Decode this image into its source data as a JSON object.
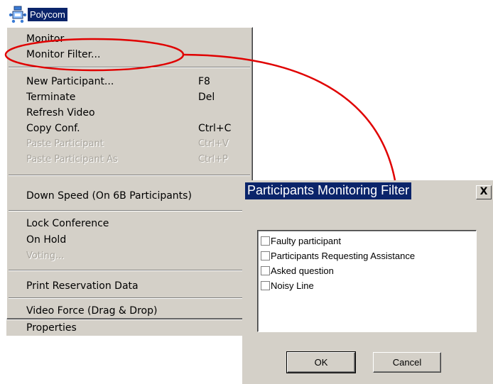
{
  "node": {
    "label": "Polycom",
    "icon": "conference-node-icon"
  },
  "menu": {
    "items": [
      {
        "label": "Monitor",
        "shortcut": ""
      },
      {
        "label": "Monitor Filter...",
        "shortcut": ""
      },
      {
        "label": "New Participant...",
        "shortcut": "F8"
      },
      {
        "label": "Terminate",
        "shortcut": "Del"
      },
      {
        "label": "Refresh Video",
        "shortcut": ""
      },
      {
        "label": "Copy Conf.",
        "shortcut": "Ctrl+C"
      },
      {
        "label": "Paste Participant",
        "shortcut": "Ctrl+V",
        "disabled": true
      },
      {
        "label": "Paste Participant As",
        "shortcut": "Ctrl+P",
        "disabled": true
      },
      {
        "label": "Down Speed (On 6B Participants)",
        "shortcut": ""
      },
      {
        "label": "Lock Conference",
        "shortcut": ""
      },
      {
        "label": "On Hold",
        "shortcut": ""
      },
      {
        "label": "Voting...",
        "shortcut": "",
        "disabled": true
      },
      {
        "label": "Print Reservation Data",
        "shortcut": ""
      },
      {
        "label": "Video Force (Drag & Drop)",
        "shortcut": ""
      },
      {
        "label": "Properties",
        "shortcut": ""
      }
    ]
  },
  "dialog": {
    "title": "Participants Monitoring Filter",
    "close_label": "X",
    "options": [
      {
        "label": "Faulty participant",
        "checked": false
      },
      {
        "label": "Participants Requesting Assistance",
        "checked": false
      },
      {
        "label": "Asked question",
        "checked": false
      },
      {
        "label": "Noisy Line",
        "checked": false
      }
    ],
    "ok_label": "OK",
    "cancel_label": "Cancel"
  },
  "colors": {
    "menu_bg": "#d4d0c8",
    "highlight": "#0a246a",
    "callout": "#e00000"
  }
}
